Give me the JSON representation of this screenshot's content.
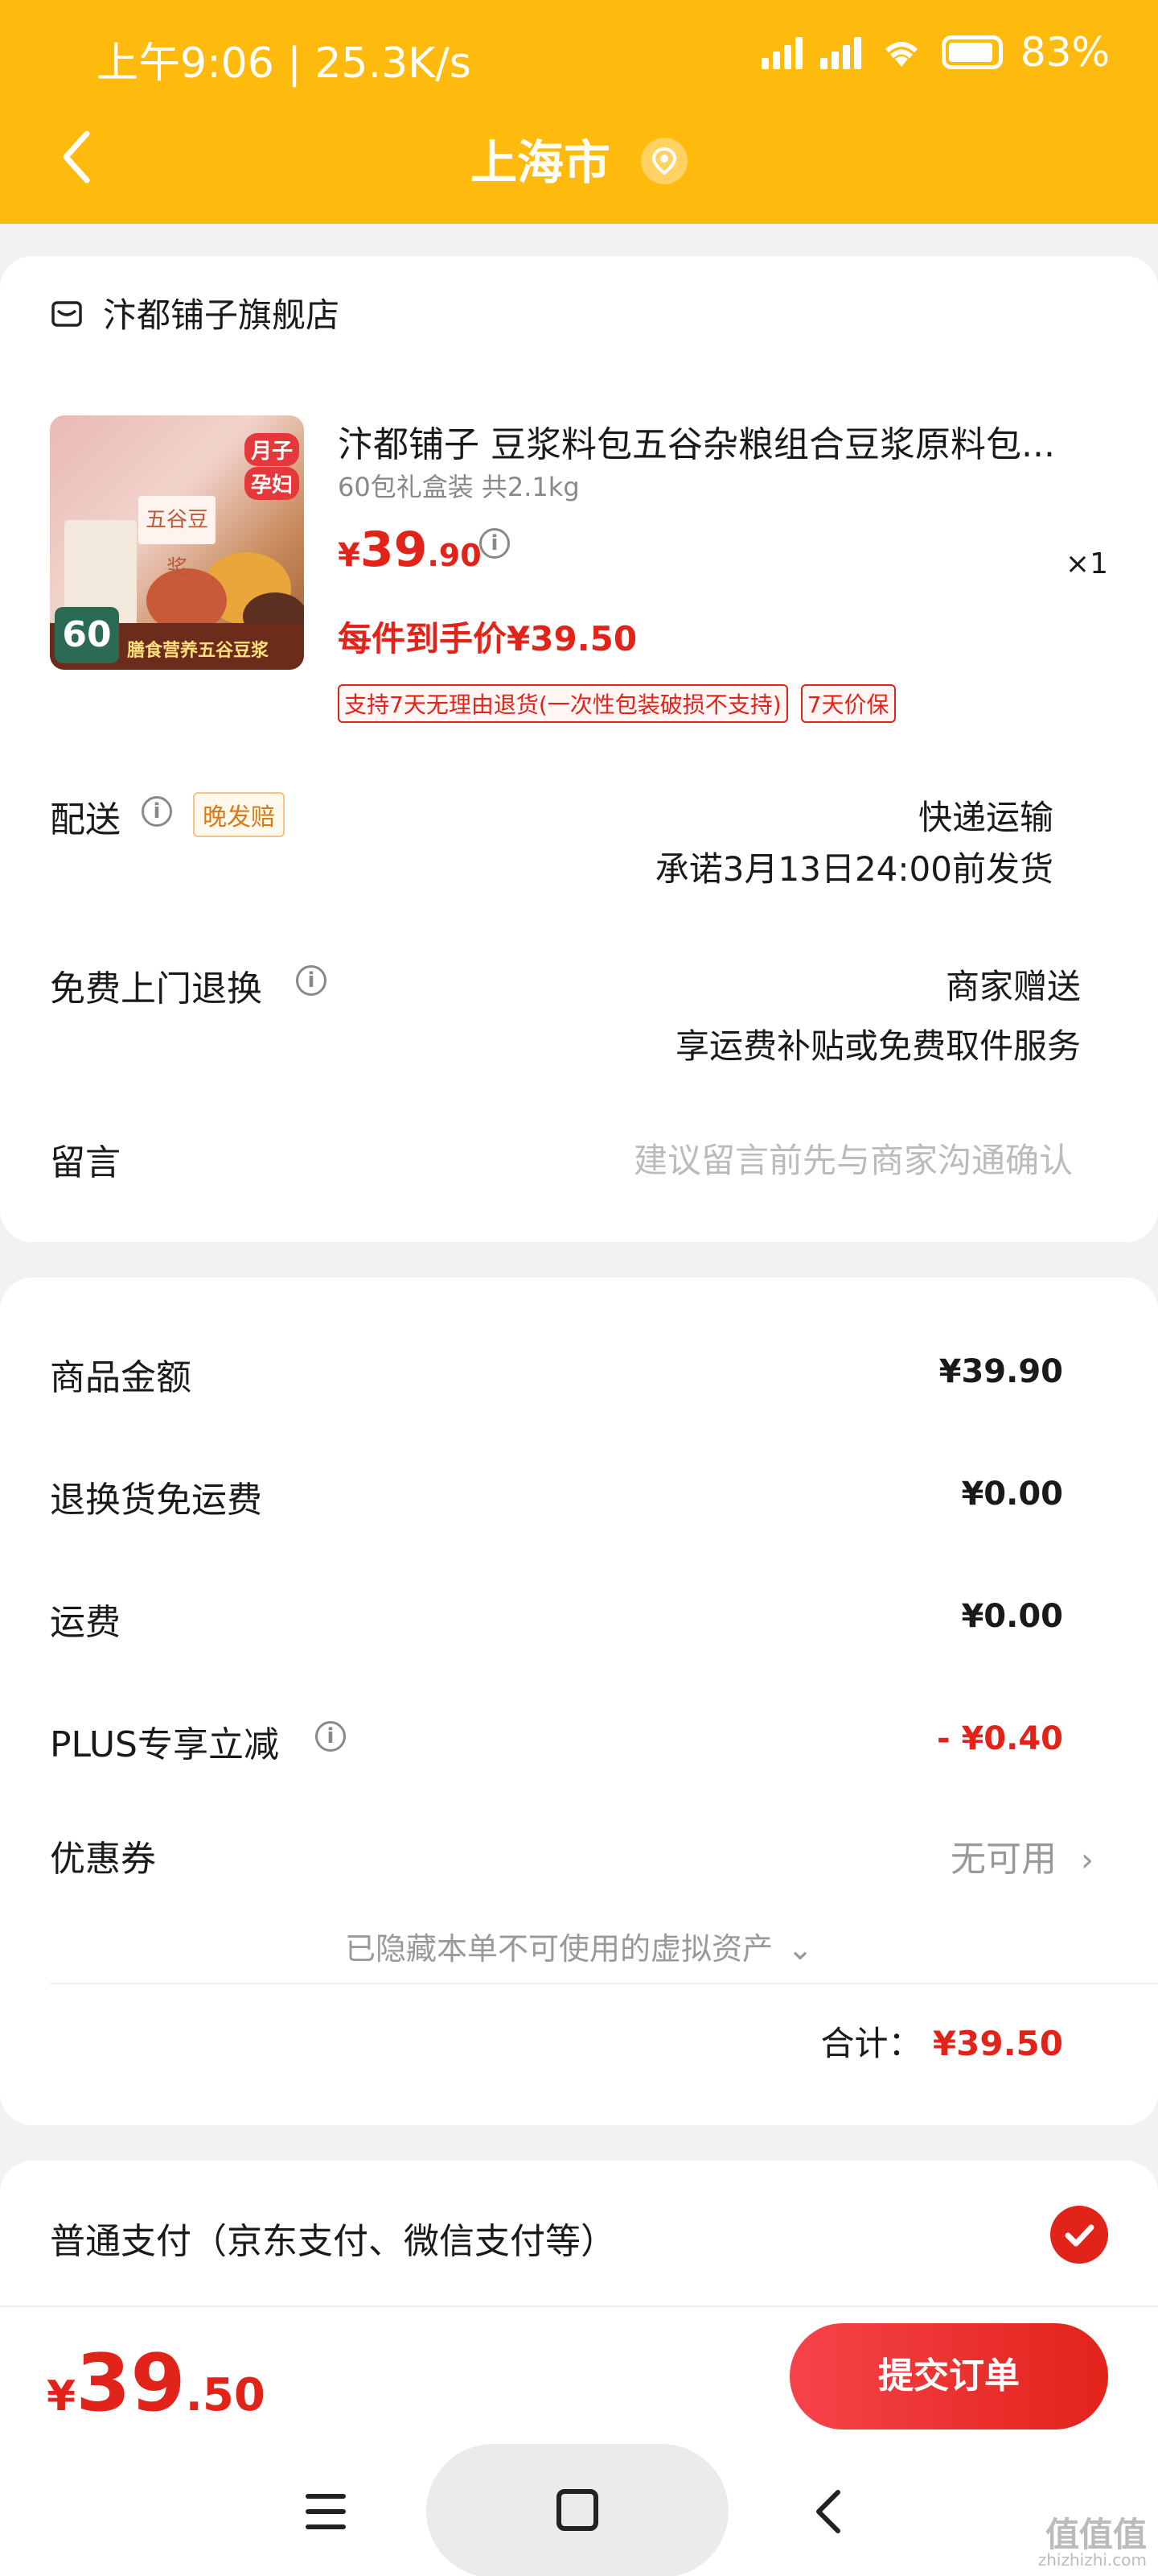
{
  "status_bar": {
    "time_speed": "上午9:06 | 25.3K/s",
    "battery": "83%"
  },
  "nav": {
    "title": "上海市"
  },
  "store": {
    "name": "汴都铺子旗舰店"
  },
  "product": {
    "title": "汴都铺子 豆浆料包五谷杂粮组合豆浆原料包...",
    "spec": "60包礼盒装 共2.1kg",
    "price_symbol": "¥",
    "price_int": "39",
    "price_dec": ".90",
    "quantity": "×1",
    "each_price": "每件到手价¥39.50",
    "tags": [
      "支持7天无理由退货(一次性包装破损不支持)",
      "7天价保"
    ],
    "image_labels": {
      "badge1": "月子",
      "badge2": "孕妇",
      "box_text": "五谷豆浆",
      "count": "60",
      "strip": "膳食营养五谷豆浆"
    }
  },
  "delivery": {
    "label": "配送",
    "late_tag": "晚发赔",
    "method": "快递运输",
    "promise": "承诺3月13日24:00前发货"
  },
  "return": {
    "label": "免费上门退换",
    "value1": "商家赠送",
    "value2": "享运费补贴或免费取件服务"
  },
  "message": {
    "label": "留言",
    "placeholder": "建议留言前先与商家沟通确认"
  },
  "summary": {
    "goods_label": "商品金额",
    "goods_value": "¥39.90",
    "return_fee_label": "退换货免运费",
    "return_fee_value": "¥0.00",
    "shipping_label": "运费",
    "shipping_value": "¥0.00",
    "plus_label": "PLUS专享立减",
    "plus_value": "- ¥0.40",
    "coupon_label": "优惠券",
    "coupon_value": "无可用",
    "hidden_assets": "已隐藏本单不可使用的虚拟资产",
    "total_label": "合计：",
    "total_value": "¥39.50"
  },
  "payment": {
    "method": "普通支付（京东支付、微信支付等）"
  },
  "footer": {
    "price_symbol": "¥",
    "price_int": "39",
    "price_dec": ".50",
    "submit": "提交订单"
  },
  "watermark": {
    "text": "值值值",
    "sub": "zhizhizhi.com"
  },
  "colors": {
    "header_bg": "#ffbb0d",
    "accent_red": "#e2231a"
  }
}
